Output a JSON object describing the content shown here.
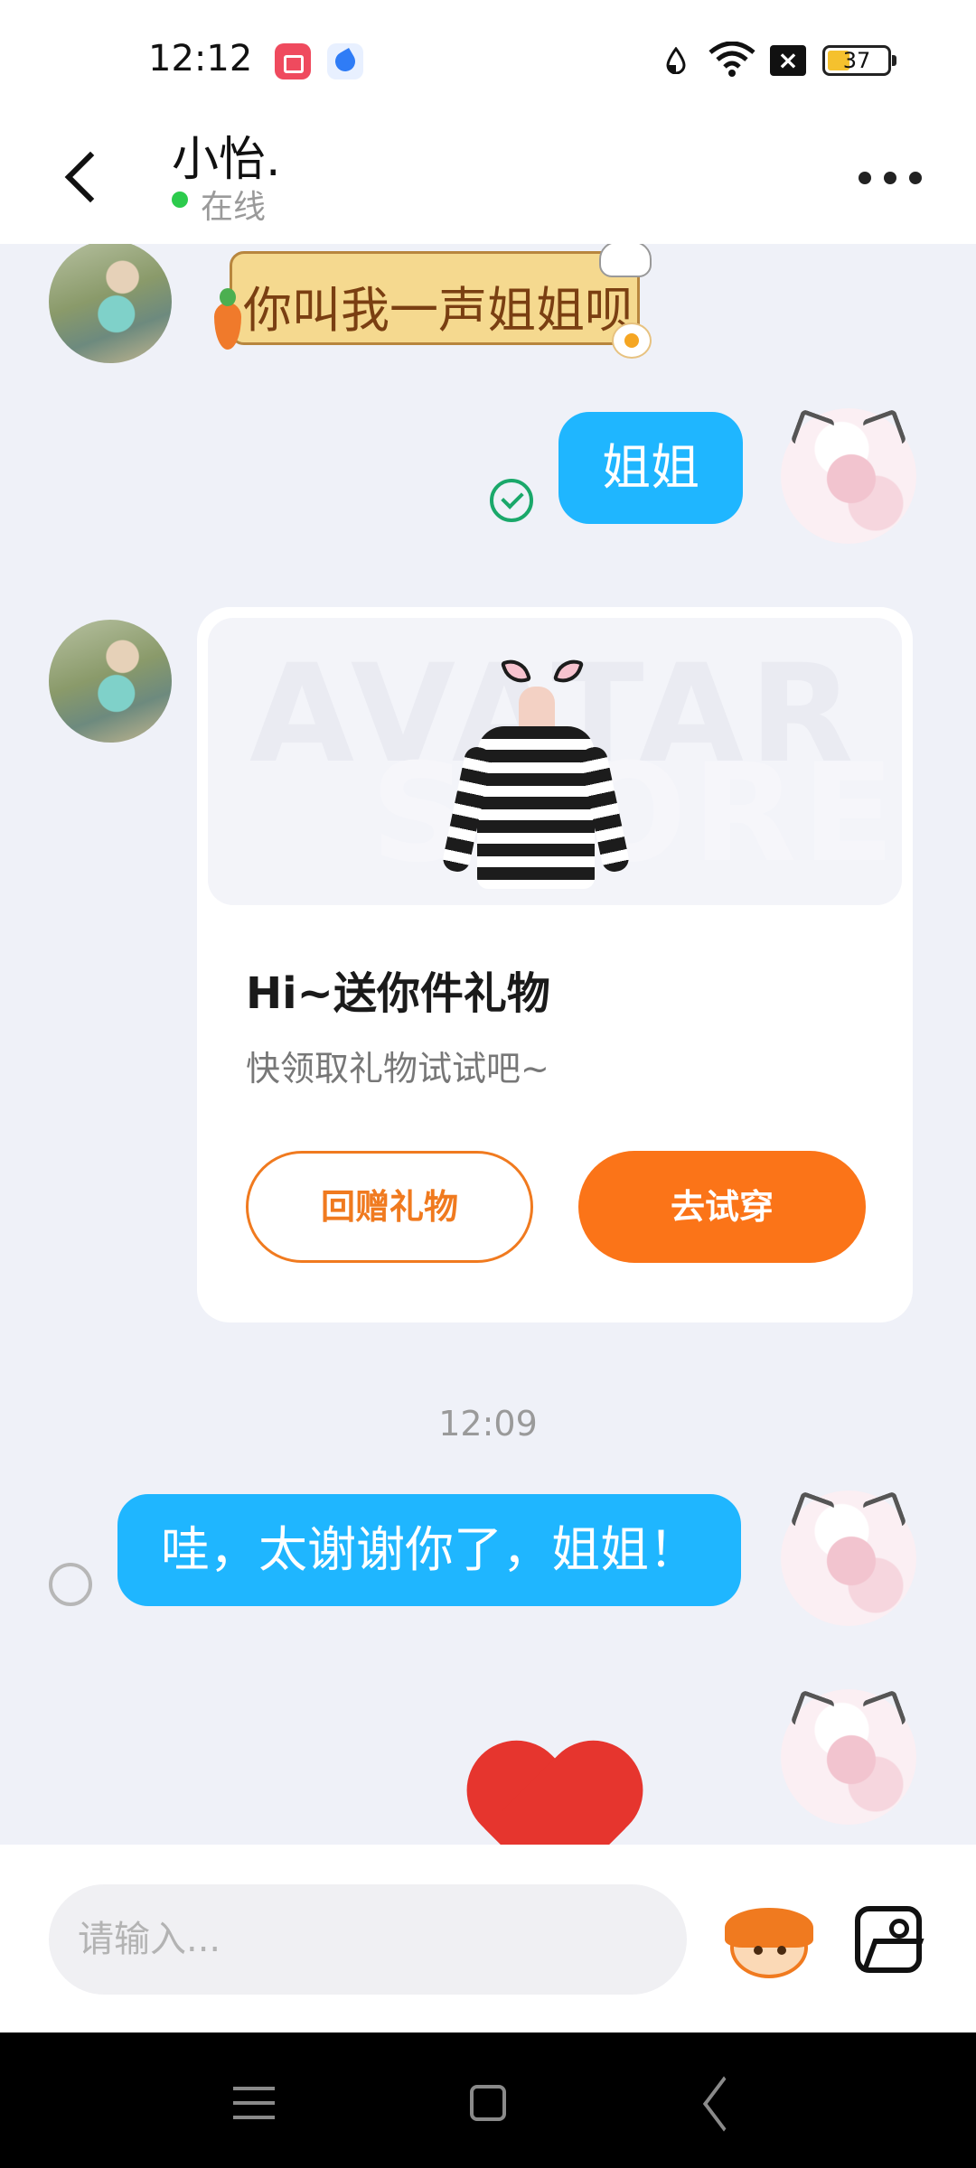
{
  "status_bar": {
    "time": "12:12",
    "battery_level": "37",
    "icons": [
      "screen-record-icon",
      "app-notification-icon",
      "data-saver-icon",
      "wifi-icon",
      "no-sim-icon",
      "battery-icon"
    ]
  },
  "header": {
    "contact_name": "小怡.",
    "status": "在线",
    "status_color": "#2ccb4c",
    "back_icon": "chevron-left-icon",
    "more_icon": "more-dots-icon"
  },
  "messages": [
    {
      "side": "left",
      "type": "sticker",
      "text": "你叫我一声姐姐呗"
    },
    {
      "side": "right",
      "type": "text",
      "text": "姐姐",
      "state": "read"
    },
    {
      "side": "left",
      "type": "gift_card",
      "watermark_line1": "AVATAR",
      "watermark_line2": "STORE",
      "title": "Hi~送你件礼物",
      "subtitle": "快领取礼物试试吧~",
      "secondary_button": "回赠礼物",
      "primary_button": "去试穿"
    },
    {
      "type": "timestamp",
      "text": "12:09"
    },
    {
      "side": "right",
      "type": "text",
      "text": "哇，太谢谢你了，姐姐！",
      "state": "pending"
    },
    {
      "side": "right",
      "type": "sticker",
      "icon": "heart-sticker-icon"
    }
  ],
  "input_bar": {
    "placeholder": "请输入...",
    "value": "",
    "emoji_icon": "emoji-avatar-icon",
    "image_icon": "image-picker-icon"
  },
  "colors": {
    "bubble_blue": "#1fb6ff",
    "accent_orange": "#fb7418",
    "chat_background": "#eff1f8"
  },
  "nav_bar": {
    "icons": [
      "menu-icon",
      "home-icon",
      "back-icon"
    ]
  }
}
